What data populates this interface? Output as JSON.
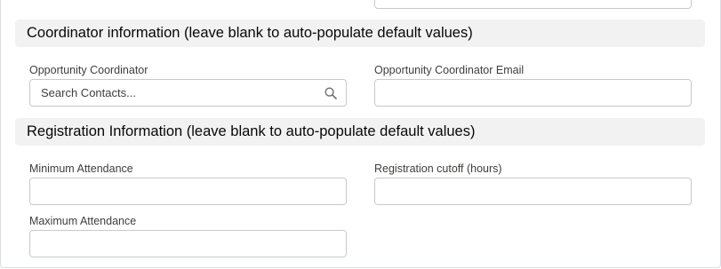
{
  "sections": {
    "coordinator": {
      "title": "Coordinator information (leave blank to auto-populate default values)",
      "fields": {
        "opportunity_coordinator": {
          "label": "Opportunity Coordinator",
          "placeholder": "Search Contacts...",
          "icon": "search-icon"
        },
        "opportunity_coordinator_email": {
          "label": "Opportunity Coordinator Email",
          "value": ""
        }
      }
    },
    "registration": {
      "title": "Registration Information (leave blank to auto-populate default values)",
      "fields": {
        "minimum_attendance": {
          "label": "Minimum Attendance",
          "value": ""
        },
        "registration_cutoff": {
          "label": "Registration cutoff (hours)",
          "value": ""
        },
        "maximum_attendance": {
          "label": "Maximum Attendance",
          "value": ""
        }
      }
    }
  },
  "colors": {
    "section_header_bg": "#f3f2f2",
    "input_border": "#c9c9c9",
    "label_text": "#3e3e3c"
  }
}
